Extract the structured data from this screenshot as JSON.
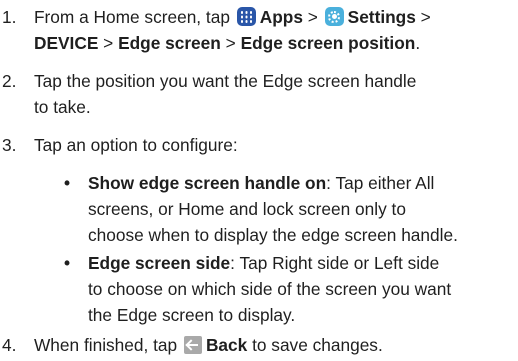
{
  "steps": [
    {
      "number": "1.",
      "prefix": "From a Home screen, tap",
      "apps_icon": "apps-grid-icon",
      "apps": "Apps",
      "sep1": ">",
      "settings_icon": "settings-gear-icon",
      "settings": "Settings",
      "sep2": ">",
      "device": "DEVICE",
      "sep3": ">",
      "edge_screen": "Edge screen",
      "sep4": ">",
      "edge_position": "Edge screen position",
      "period": "."
    },
    {
      "number": "2.",
      "line1": "Tap the position you want the Edge screen handle",
      "line2": "to take."
    },
    {
      "number": "3.",
      "text": "Tap an option to configure:"
    },
    {
      "number": "4.",
      "prefix": "When finished, tap",
      "back_icon": "back-arrow-icon",
      "back": "Back",
      "suffix": "to save changes."
    }
  ],
  "bullets": [
    {
      "marker": "•",
      "term": "Show edge screen handle on",
      "line1_rest": ": Tap either All",
      "line2": "screens, or Home and lock screen only to",
      "line3": "choose when to display the edge screen handle."
    },
    {
      "marker": "•",
      "term": "Edge screen side",
      "line1_rest": ": Tap Right side or Left side",
      "line2": "to choose on which side of the screen you want",
      "line3": "the Edge screen to display."
    }
  ],
  "colors": {
    "apps_icon": "#2a56a8",
    "settings_icon": "#4ab0dc",
    "back_icon": "#a9a9a9",
    "text": "#1f1f1f"
  }
}
